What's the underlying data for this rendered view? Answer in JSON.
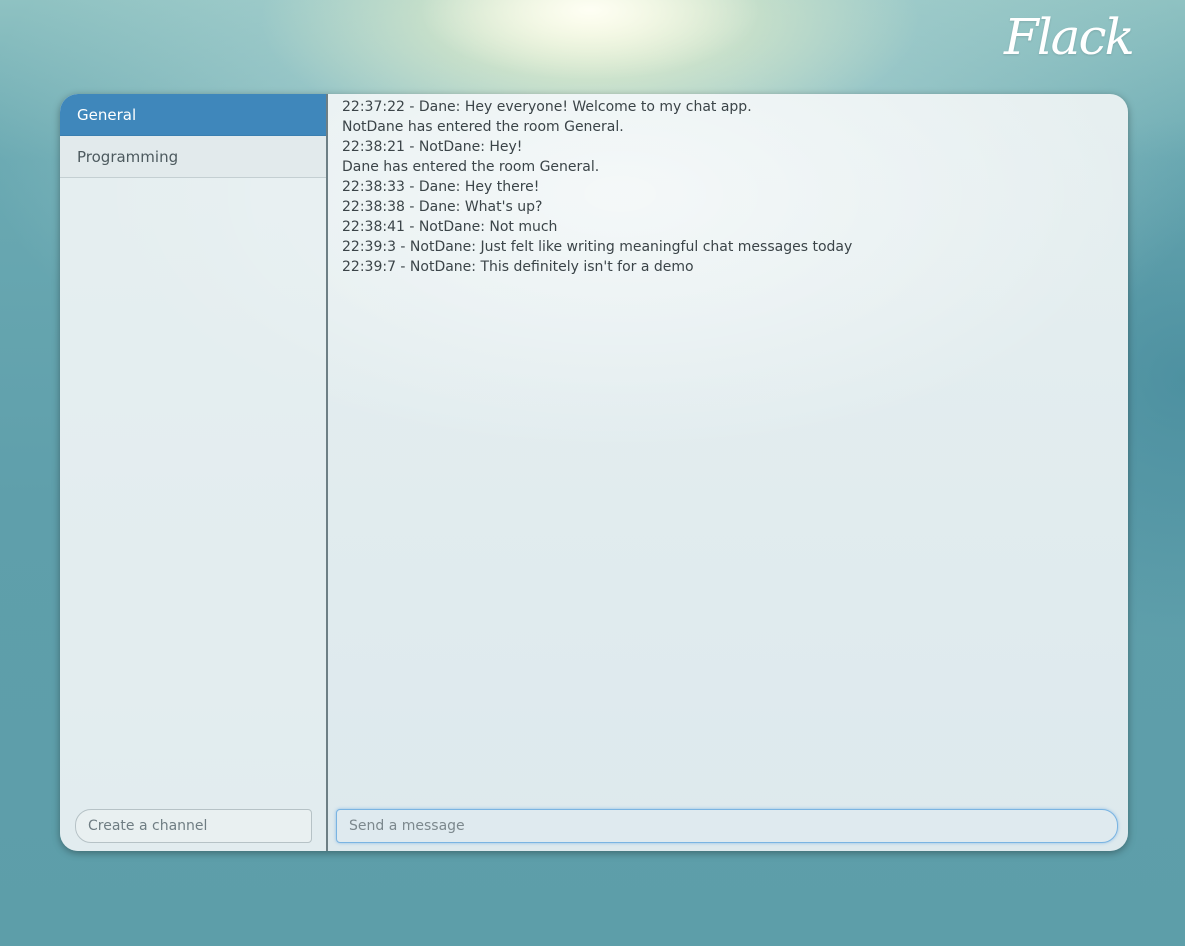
{
  "app": {
    "logo": "Flack"
  },
  "channels": [
    {
      "label": "General",
      "active": true
    },
    {
      "label": "Programming",
      "active": false
    }
  ],
  "create_channel": {
    "placeholder": "Create a channel",
    "value": ""
  },
  "messages": [
    "22:37:22 - Dane: Hey everyone! Welcome to my chat app.",
    "NotDane has entered the room General.",
    "22:38:21 - NotDane: Hey!",
    "Dane has entered the room General.",
    "22:38:33 - Dane: Hey there!",
    "22:38:38 - Dane: What's up?",
    "22:38:41 - NotDane: Not much",
    "22:39:3 - NotDane: Just felt like writing meaningful chat messages today",
    "22:39:7 - NotDane: This definitely isn't for a demo"
  ],
  "send_message": {
    "placeholder": "Send a message",
    "value": ""
  },
  "colors": {
    "active_channel": "#3f87bb",
    "page_background": "#5f9fab"
  }
}
